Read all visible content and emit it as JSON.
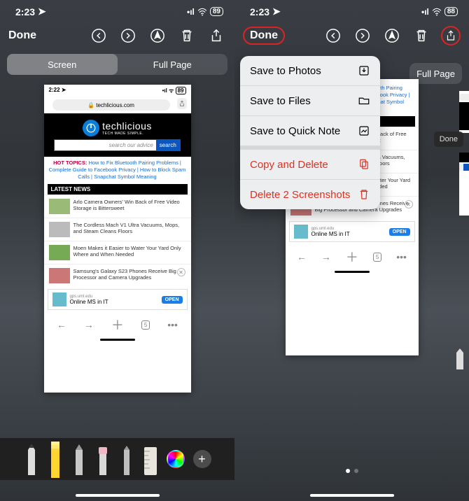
{
  "status": {
    "time": "2:23",
    "arrow": "➤",
    "signal": "••||",
    "wifi": "wifi",
    "battery_left": "89",
    "battery_right": "88"
  },
  "topbar": {
    "done": "Done"
  },
  "segmented": {
    "screen": "Screen",
    "fullpage": "Full Page"
  },
  "screenshot": {
    "time": "2:22",
    "arrow": "➤",
    "battery": "89",
    "url": "techlicious.com",
    "lock": "🔒",
    "brand": "techlicious",
    "tagline": "TECH MADE SIMPLE.",
    "search_placeholder": "search our advice",
    "search_btn": "search",
    "hot_label": "HOT TOPICS:",
    "hot_links": "How to Fix Bluetooth Pairing Problems | Complete Guide to Facebook Privacy | How to Block Spam Calls | Snapchat Symbol Meaning",
    "latest_label": "LATEST NEWS",
    "items": [
      "Arlo Camera Owners' Win Back of Free Video Storage is Bittersweet",
      "The Cordless Mach V1 Ultra Vacuums, Mops, and Steam Cleans Floors",
      "Moen Makes it Easier to Water Your Yard Only Where and When Needed",
      "Samsung's Galaxy S23 Phones Receive Big Processor and Camera Upgrades"
    ],
    "ad_domain": "gps.uml.edu",
    "ad_text": "Online MS in IT",
    "ad_btn": "OPEN",
    "tabcount": "5"
  },
  "menu": {
    "savePhotos": "Save to Photos",
    "saveFiles": "Save to Files",
    "saveQuick": "Save to Quick Note",
    "copyDelete": "Copy and Delete",
    "deleteN": "Delete 2 Screenshots"
  },
  "mini": {
    "done": "Done"
  }
}
